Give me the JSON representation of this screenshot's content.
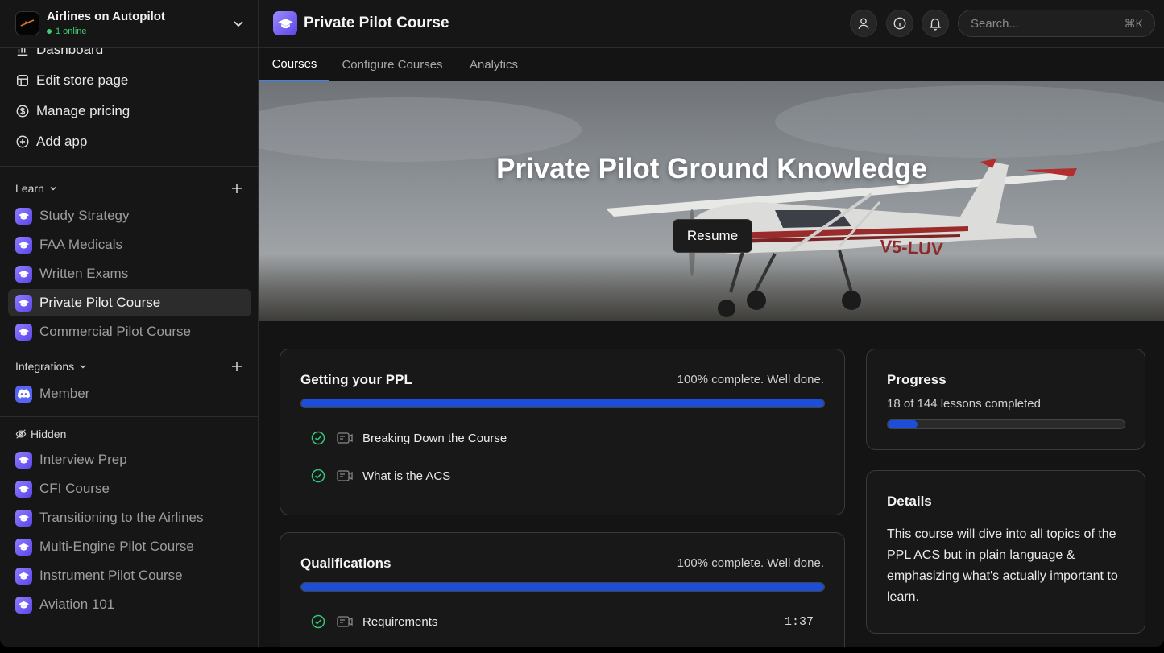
{
  "workspace": {
    "name": "Airlines on Autopilot",
    "status": "1 online"
  },
  "nav": [
    {
      "label": "Dashboard",
      "icon": "chart-icon"
    },
    {
      "label": "Edit store page",
      "icon": "store-icon"
    },
    {
      "label": "Manage pricing",
      "icon": "dollar-icon"
    },
    {
      "label": "Add app",
      "icon": "plus-circle-icon"
    }
  ],
  "learn": {
    "heading": "Learn",
    "items": [
      {
        "label": "Study Strategy"
      },
      {
        "label": "FAA Medicals"
      },
      {
        "label": "Written Exams"
      },
      {
        "label": "Private Pilot Course"
      },
      {
        "label": "Commercial Pilot Course"
      }
    ]
  },
  "integrations": {
    "heading": "Integrations",
    "items": [
      {
        "label": "Member"
      }
    ]
  },
  "hidden": {
    "heading": "Hidden",
    "items": [
      {
        "label": "Interview Prep"
      },
      {
        "label": "CFI Course"
      },
      {
        "label": "Transitioning to the Airlines"
      },
      {
        "label": "Multi-Engine Pilot Course"
      },
      {
        "label": "Instrument Pilot Course"
      },
      {
        "label": "Aviation 101"
      }
    ]
  },
  "header": {
    "title": "Private Pilot Course",
    "search_placeholder": "Search...",
    "search_shortcut": "⌘K"
  },
  "tabs": [
    {
      "label": "Courses"
    },
    {
      "label": "Configure Courses"
    },
    {
      "label": "Analytics"
    }
  ],
  "hero": {
    "title": "Private Pilot Ground Knowledge",
    "button": "Resume",
    "registration": "V5-LUV"
  },
  "modules": [
    {
      "title": "Getting your PPL",
      "status": "100% complete. Well done.",
      "progress": 1.0,
      "lessons": [
        {
          "title": "Breaking Down the Course"
        },
        {
          "title": "What is the ACS"
        }
      ]
    },
    {
      "title": "Qualifications",
      "status": "100% complete. Well done.",
      "progress": 1.0,
      "lessons": [
        {
          "title": "Requirements",
          "duration": "1:37"
        }
      ]
    }
  ],
  "progress_card": {
    "title": "Progress",
    "summary": "18 of 144 lessons completed",
    "completed": 18,
    "total": 144
  },
  "details_card": {
    "title": "Details",
    "text": "This course will dive into all topics of the PPL ACS but in plain language & emphasizing what's actually important to learn."
  },
  "colors": {
    "accent": "#1d4ed8",
    "app_icon": "#6b57f0",
    "online": "#3bd16f"
  }
}
